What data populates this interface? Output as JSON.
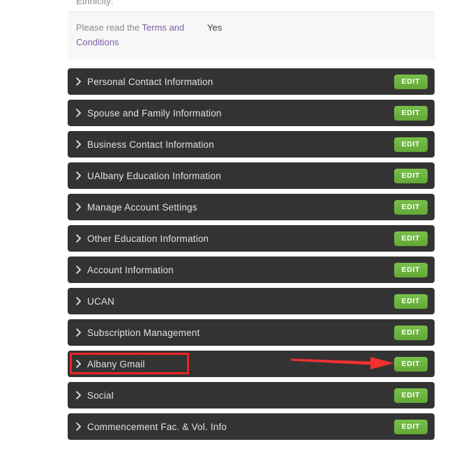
{
  "form": {
    "partial_field": {
      "label": "Ethnicity:"
    },
    "terms_field": {
      "label_prefix": "Please read the ",
      "link_text": "Terms and Conditions",
      "value": "Yes"
    }
  },
  "accordion": {
    "edit_label": "EDIT",
    "chevron_icon": "chevron-right-icon",
    "rows": [
      {
        "title": "Personal Contact Information"
      },
      {
        "title": "Spouse and Family Information"
      },
      {
        "title": "Business Contact Information"
      },
      {
        "title": "UAlbany Education Information"
      },
      {
        "title": "Manage Account Settings"
      },
      {
        "title": "Other Education Information"
      },
      {
        "title": "Account Information"
      },
      {
        "title": "UCAN"
      },
      {
        "title": "Subscription Management"
      },
      {
        "title": "Albany Gmail"
      },
      {
        "title": "Social"
      },
      {
        "title": "Commencement Fac. & Vol. Info"
      }
    ]
  },
  "annotations": {
    "highlight_color": "#ee2222",
    "arrow_color": "#f23030",
    "highlighted_row_title": "Albany Gmail"
  },
  "colors": {
    "row_background": "#333333",
    "edit_button": "#6cb33f",
    "link": "#7b5ea7",
    "field_background": "#f7f7f7",
    "page_background": "#ffffff"
  }
}
